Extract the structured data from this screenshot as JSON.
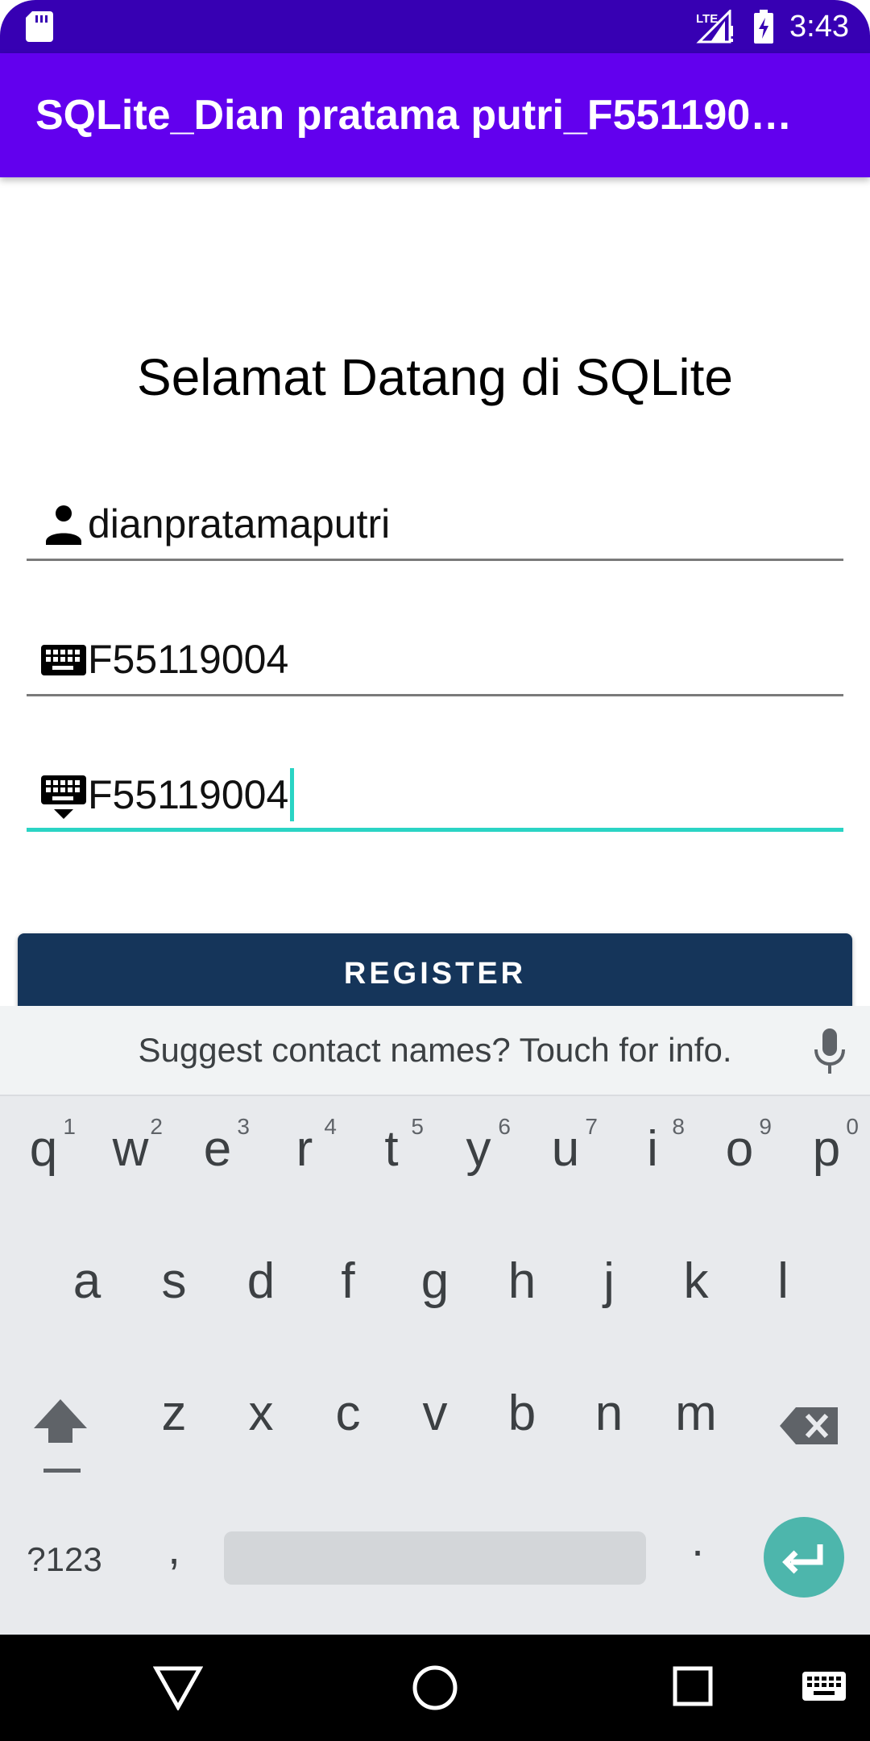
{
  "status_bar": {
    "time": "3:43",
    "network": "LTE"
  },
  "app_bar": {
    "title": "SQLite_Dian pratama putri_F551190…"
  },
  "welcome": "Selamat Datang di SQLite",
  "form": {
    "username": {
      "value": "dianpratamaputri",
      "icon": "person-icon"
    },
    "password": {
      "value": "F55119004",
      "icon": "keyboard-icon"
    },
    "confirm_password": {
      "value": "F55119004",
      "icon": "keyboard-hide-icon"
    },
    "register_label": "REGISTER"
  },
  "keyboard": {
    "suggestion": "Suggest contact names? Touch for info.",
    "row1": [
      {
        "ch": "q",
        "hint": "1"
      },
      {
        "ch": "w",
        "hint": "2"
      },
      {
        "ch": "e",
        "hint": "3"
      },
      {
        "ch": "r",
        "hint": "4"
      },
      {
        "ch": "t",
        "hint": "5"
      },
      {
        "ch": "y",
        "hint": "6"
      },
      {
        "ch": "u",
        "hint": "7"
      },
      {
        "ch": "i",
        "hint": "8"
      },
      {
        "ch": "o",
        "hint": "9"
      },
      {
        "ch": "p",
        "hint": "0"
      }
    ],
    "row2": [
      "a",
      "s",
      "d",
      "f",
      "g",
      "h",
      "j",
      "k",
      "l"
    ],
    "row3": [
      "z",
      "x",
      "c",
      "v",
      "b",
      "n",
      "m"
    ],
    "symbols_label": "?123",
    "comma": ",",
    "period": "."
  },
  "colors": {
    "status_bar": "#3700b3",
    "app_bar": "#6200ee",
    "focus_accent": "#2ad4c4",
    "button": "#15355a",
    "enter_key": "#4db6ac"
  }
}
